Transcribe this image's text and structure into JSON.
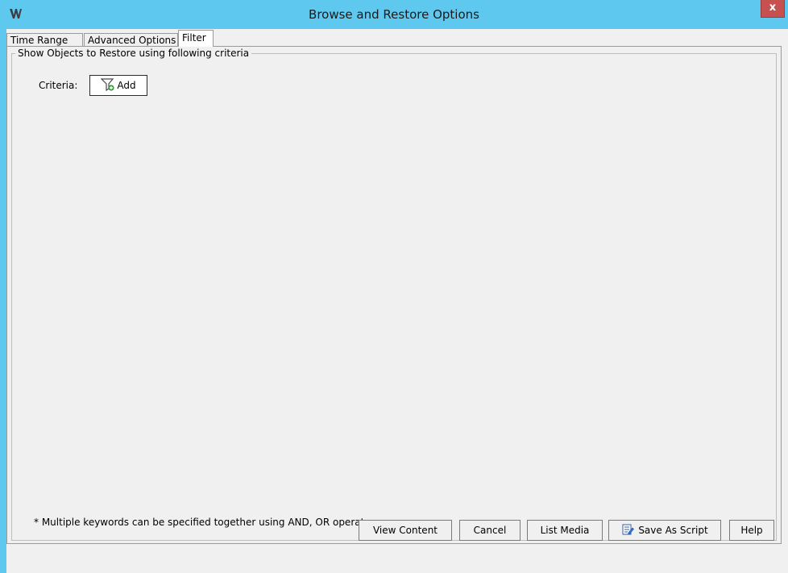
{
  "window": {
    "title": "Browse and Restore Options",
    "close_label": "x",
    "titlebar_color": "#5ec8ef"
  },
  "tabs": [
    {
      "label": "Time Range",
      "active": false
    },
    {
      "label": "Advanced Options",
      "active": false
    },
    {
      "label": "Filter",
      "active": true
    }
  ],
  "filter": {
    "group_title": "Show Objects to Restore using following criteria",
    "criteria_label": "Criteria:",
    "add_label": "Add",
    "add_icon": "filter-add-icon",
    "footnote": "*  Multiple keywords can be specified together using  AND, OR operator."
  },
  "buttons": {
    "view_content": "View Content",
    "cancel": "Cancel",
    "list_media": "List Media",
    "save_as_script": "Save As Script",
    "save_icon": "script-save-icon",
    "help": "Help"
  }
}
